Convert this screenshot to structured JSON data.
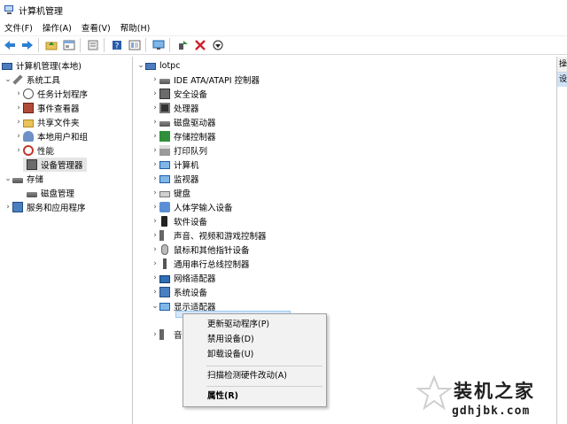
{
  "window": {
    "title": "计算机管理"
  },
  "menu": [
    "文件(F)",
    "操作(A)",
    "查看(V)",
    "帮助(H)"
  ],
  "toolbar": [
    "back-arrow-icon",
    "forward-arrow-icon",
    "up-folder-icon",
    "show-tree-icon",
    "properties-icon",
    "help-icon",
    "console-icon",
    "monitor-icon",
    "enable-device-icon",
    "remove-icon",
    "update-driver-icon"
  ],
  "left_tree": [
    {
      "label": "计算机管理(本地)",
      "icon": "computer-mgmt-icon",
      "level": 0
    },
    {
      "label": "系统工具",
      "icon": "tools-icon",
      "level": 1
    },
    {
      "label": "任务计划程序",
      "icon": "clock-icon",
      "level": 2
    },
    {
      "label": "事件查看器",
      "icon": "event-viewer-icon",
      "level": 2
    },
    {
      "label": "共享文件夹",
      "icon": "shared-folder-icon",
      "level": 2
    },
    {
      "label": "本地用户和组",
      "icon": "users-icon",
      "level": 2
    },
    {
      "label": "性能",
      "icon": "performance-icon",
      "level": 2
    },
    {
      "label": "设备管理器",
      "icon": "device-manager-icon",
      "level": 2,
      "selected": true
    },
    {
      "label": "存储",
      "icon": "storage-icon",
      "level": 1
    },
    {
      "label": "磁盘管理",
      "icon": "disk-mgmt-icon",
      "level": 2
    },
    {
      "label": "服务和应用程序",
      "icon": "services-icon",
      "level": 1
    }
  ],
  "device_tree": {
    "root": "lotpc",
    "categories": [
      {
        "label": "IDE ATA/ATAPI 控制器",
        "icon": "ide-controller-icon"
      },
      {
        "label": "安全设备",
        "icon": "security-device-icon"
      },
      {
        "label": "处理器",
        "icon": "processor-icon"
      },
      {
        "label": "磁盘驱动器",
        "icon": "disk-drive-icon"
      },
      {
        "label": "存储控制器",
        "icon": "storage-controller-icon"
      },
      {
        "label": "打印队列",
        "icon": "printer-icon"
      },
      {
        "label": "计算机",
        "icon": "computer-icon"
      },
      {
        "label": "监视器",
        "icon": "monitor-icon"
      },
      {
        "label": "键盘",
        "icon": "keyboard-icon"
      },
      {
        "label": "人体学输入设备",
        "icon": "hid-icon"
      },
      {
        "label": "软件设备",
        "icon": "software-device-icon"
      },
      {
        "label": "声音、视频和游戏控制器",
        "icon": "sound-icon"
      },
      {
        "label": "鼠标和其他指针设备",
        "icon": "mouse-icon"
      },
      {
        "label": "通用串行总线控制器",
        "icon": "usb-icon"
      },
      {
        "label": "网络适配器",
        "icon": "network-adapter-icon"
      },
      {
        "label": "系统设备",
        "icon": "system-device-icon"
      },
      {
        "label": "显示适配器",
        "icon": "display-adapter-icon",
        "expanded": true
      }
    ],
    "partial_label": "音"
  },
  "context_menu": [
    {
      "label": "更新驱动程序(P)"
    },
    {
      "label": "禁用设备(D)"
    },
    {
      "label": "卸载设备(U)"
    },
    {
      "label": "扫描检测硬件改动(A)"
    },
    {
      "label": "属性(R)",
      "bold": true
    }
  ],
  "right_pane": {
    "header": "操",
    "selected": "设"
  },
  "watermark": {
    "main": "装机之家",
    "sub": "gdhjbk.com"
  }
}
